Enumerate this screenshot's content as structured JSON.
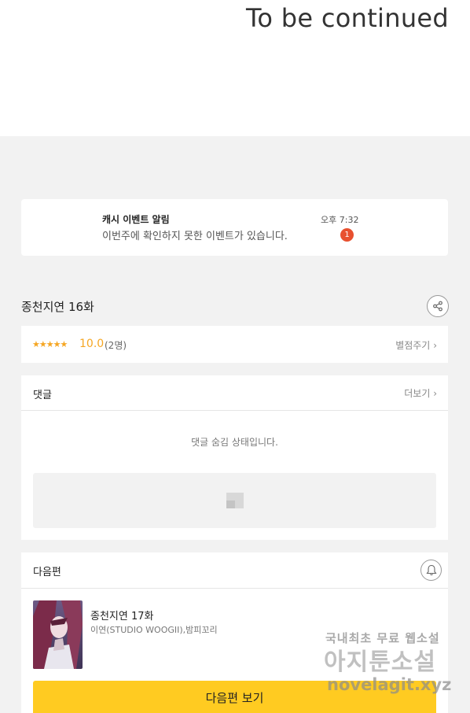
{
  "header": {
    "to_be_continued": "To be continued"
  },
  "notification": {
    "title": "캐시 이벤트 알림",
    "message": "이번주에 확인하지 못한 이벤트가 있습니다.",
    "time": "오후 7:32",
    "badge_count": "1",
    "badge_color": "#e8502f"
  },
  "episode": {
    "title": "종천지연 16화",
    "share_icon": "share-icon"
  },
  "rating": {
    "stars": "★★★★★",
    "score": "10.0",
    "count": "(2명)",
    "rate_link": "별점주기",
    "star_color": "#f5a623"
  },
  "comments": {
    "title": "댓글",
    "more_link": "더보기",
    "hidden_message": "댓글 숨김 상태입니다."
  },
  "next_episode": {
    "section_title": "다음편",
    "episode_title": "종천지연 17화",
    "authors": "이연(STUDIO WOOGII),밤피꼬리",
    "view_button": "다음편 보기",
    "button_color": "#ffcb21"
  },
  "watermark": {
    "line1": "국내최초 무료 웹소설",
    "line2": "아지툰소설",
    "line3": "novelagit.xyz"
  }
}
